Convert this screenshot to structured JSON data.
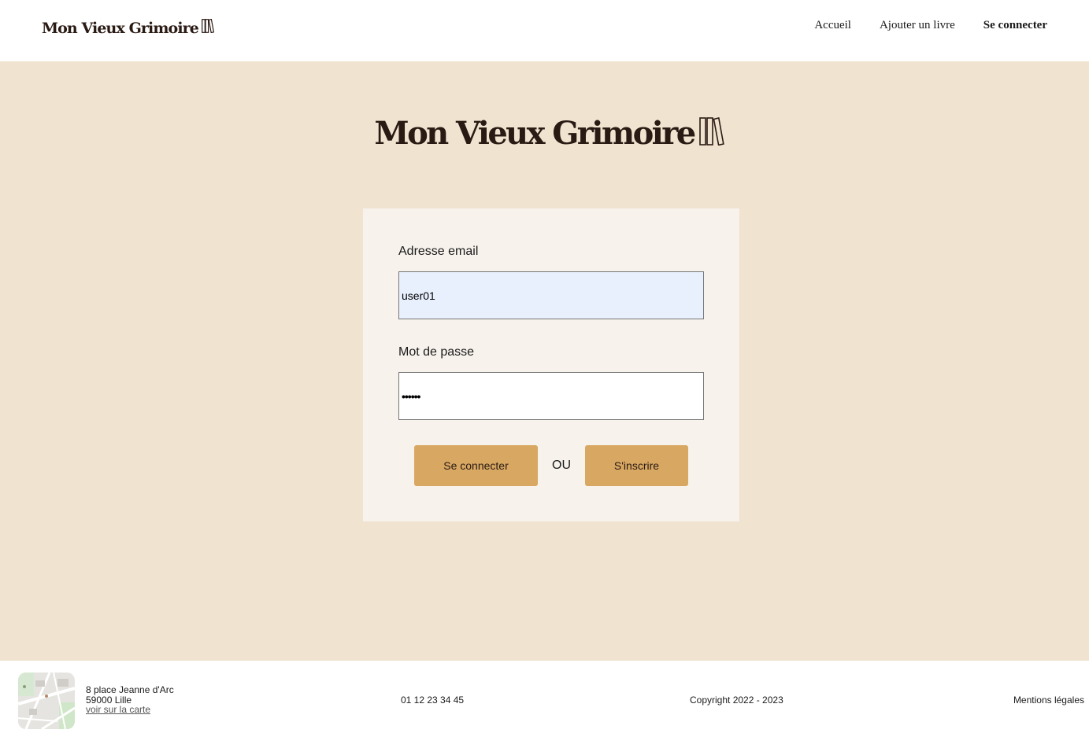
{
  "header": {
    "logo_text": "Mon Vieux Grimoire",
    "nav": {
      "home": "Accueil",
      "add_book": "Ajouter un livre",
      "login": "Se connecter"
    }
  },
  "hero": {
    "logo_text": "Mon Vieux Grimoire"
  },
  "login_form": {
    "email_label": "Adresse email",
    "email_value": "user01",
    "password_label": "Mot de passe",
    "password_value": "••••••",
    "login_button": "Se connecter",
    "or_text": "OU",
    "signup_button": "S'inscrire"
  },
  "footer": {
    "address_line1": "8 place Jeanne d'Arc",
    "address_line2": "59000 Lille",
    "map_link": "voir sur la carte",
    "phone": "01 12 23 34 45",
    "copyright": "Copyright 2022 - 2023",
    "legal": "Mentions légales"
  },
  "colors": {
    "background": "#f0e3cf",
    "card": "#f7f2ec",
    "button": "#d8a862",
    "brand_text": "#2a1a14",
    "email_autofill": "#e8f0fe"
  },
  "icons": {
    "logo": "books-icon",
    "map": "map-thumbnail"
  }
}
